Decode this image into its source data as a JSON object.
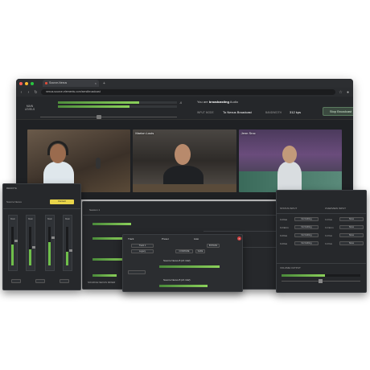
{
  "browser": {
    "tab_title": "Source-Nexus",
    "url": "nexus.source-elements.com/sendbroadcast",
    "tab_dots": [
      "#ff5f57",
      "#febc2e",
      "#28c840"
    ]
  },
  "toolbar": {
    "main_levels": "MAIN\nLEVELS",
    "broadcast_prefix": "You are",
    "broadcast_strong": "broadcasting",
    "broadcast_suffix": "Audio",
    "input_mode_label": "INPUT MODE",
    "input_mode_value": "To Nexus Broadcast",
    "bandwidth_label": "BANDWIDTH",
    "bandwidth_value": "312 kps",
    "stop_button": "Stop Broadcast",
    "meter_value": "-6",
    "meter_levels": [
      0.68,
      0.6
    ]
  },
  "participants": [
    {
      "name": ""
    },
    {
      "name": "Marion Louis"
    },
    {
      "name": "Jenn Sroc"
    }
  ],
  "left_panel": {
    "title": "REMOTE",
    "source_label": "Source Nexus",
    "yellow_button": "Connect",
    "channels": [
      {
        "label": "Main",
        "level": 0.55
      },
      {
        "label": "Main",
        "level": 0.42
      },
      {
        "label": "Main",
        "level": 0.6
      },
      {
        "label": "Main",
        "level": 0.35
      }
    ]
  },
  "center_panel": {
    "session_label": "Session 1",
    "track_label": "Track",
    "preset_label": "Preset",
    "auto_label": "Auto",
    "fields": [
      "Track 1",
      "Legacy"
    ],
    "compare_label": "COMPARE",
    "safe_label": "SAFE",
    "bypass_label": "BYPASS",
    "preset_value": "Source Nexus 8 (ch 1&2)",
    "preset_value_2": "Source Nexus 8 (ch 1&2)",
    "footer": "SOURCE NEXUS MIXER"
  },
  "right_panel": {
    "header_left": "STATUS INPUT",
    "header_right": "OVERVIEW INPUT",
    "rows": [
      {
        "a": "In Flux",
        "b": "No Nothing",
        "c": "In Flux",
        "d": "None"
      },
      {
        "a": "In Norm",
        "b": "No Nothing",
        "c": "In Norm",
        "d": "None"
      },
      {
        "a": "In Flux",
        "b": "No Nothing",
        "c": "In Flux",
        "d": "None"
      },
      {
        "a": "In Flux",
        "b": "No Nothing",
        "c": "In Flux",
        "d": "None"
      }
    ],
    "section": "VOLUME OUTPUT",
    "level": 0.55
  }
}
